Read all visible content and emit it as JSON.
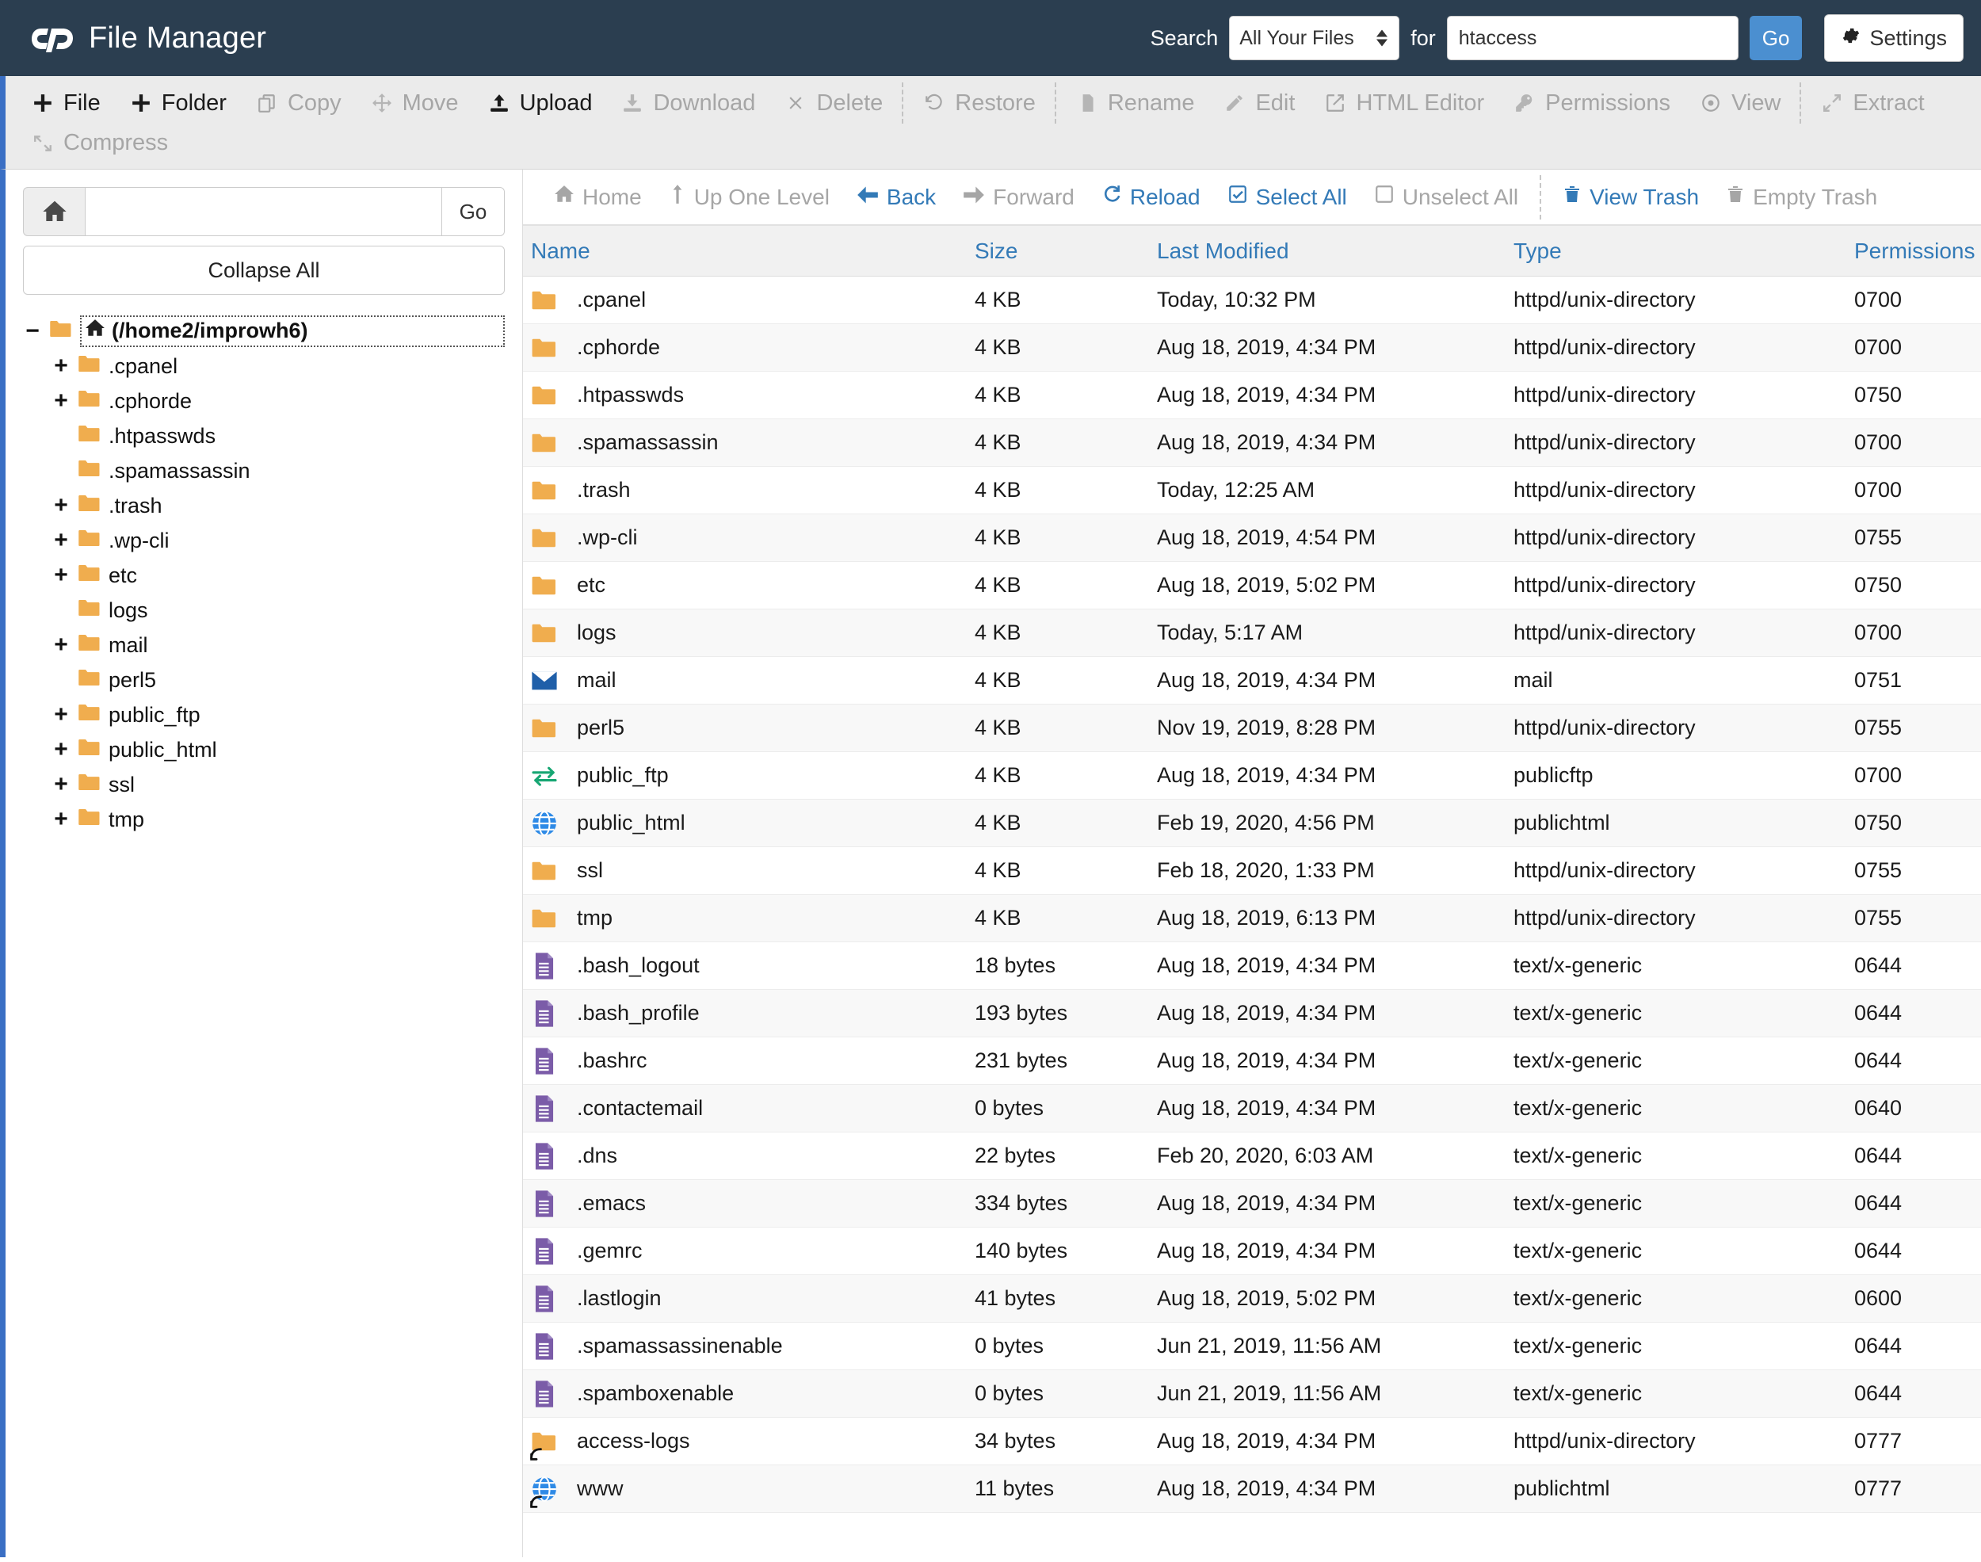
{
  "header": {
    "title": "File Manager",
    "logo_icon": "cpanel-logo-icon",
    "search_label": "Search",
    "search_scope_value": "All Your Files",
    "search_for_label": "for",
    "search_query": "htaccess",
    "search_placeholder": "",
    "go_label": "Go",
    "settings_label": "Settings",
    "settings_icon": "gear-icon",
    "accent_color": "#4b8fd0",
    "background_color": "#2b3e50"
  },
  "toolbar": {
    "row1": [
      {
        "label": "File",
        "icon": "plus-icon",
        "enabled": true
      },
      {
        "label": "Folder",
        "icon": "plus-icon",
        "enabled": true
      },
      {
        "label": "Copy",
        "icon": "copy-icon",
        "enabled": false
      },
      {
        "label": "Move",
        "icon": "move-icon",
        "enabled": false
      },
      {
        "label": "Upload",
        "icon": "upload-icon",
        "enabled": true
      },
      {
        "label": "Download",
        "icon": "download-icon",
        "enabled": false
      },
      {
        "label": "Delete",
        "icon": "x-icon",
        "enabled": false
      },
      {
        "label": "Restore",
        "icon": "restore-icon",
        "enabled": false
      },
      {
        "label": "Rename",
        "icon": "rename-icon",
        "enabled": false
      },
      {
        "label": "Edit",
        "icon": "pencil-icon",
        "enabled": false
      },
      {
        "label": "HTML Editor",
        "icon": "html-editor-icon",
        "enabled": false
      },
      {
        "label": "Permissions",
        "icon": "key-icon",
        "enabled": false
      },
      {
        "label": "View",
        "icon": "eye-icon",
        "enabled": false
      },
      {
        "label": "Extract",
        "icon": "extract-icon",
        "enabled": false
      }
    ],
    "row2": [
      {
        "label": "Compress",
        "icon": "compress-icon",
        "enabled": false
      }
    ]
  },
  "sidebar": {
    "home_icon": "home-icon",
    "path_value": "",
    "path_placeholder": "",
    "go_label": "Go",
    "collapse_all_label": "Collapse All",
    "tree": [
      {
        "label": "(/home2/improwh6)",
        "toggle": "minus",
        "level": 0,
        "icon": "folder-open-home-icon",
        "selected": true
      },
      {
        "label": ".cpanel",
        "toggle": "plus",
        "level": 1,
        "icon": "folder-icon",
        "selected": false
      },
      {
        "label": ".cphorde",
        "toggle": "plus",
        "level": 1,
        "icon": "folder-icon",
        "selected": false
      },
      {
        "label": ".htpasswds",
        "toggle": "none",
        "level": 1,
        "icon": "folder-icon",
        "selected": false
      },
      {
        "label": ".spamassassin",
        "toggle": "none",
        "level": 1,
        "icon": "folder-icon",
        "selected": false
      },
      {
        "label": ".trash",
        "toggle": "plus",
        "level": 1,
        "icon": "folder-icon",
        "selected": false
      },
      {
        "label": ".wp-cli",
        "toggle": "plus",
        "level": 1,
        "icon": "folder-icon",
        "selected": false
      },
      {
        "label": "etc",
        "toggle": "plus",
        "level": 1,
        "icon": "folder-icon",
        "selected": false
      },
      {
        "label": "logs",
        "toggle": "none",
        "level": 1,
        "icon": "folder-icon",
        "selected": false
      },
      {
        "label": "mail",
        "toggle": "plus",
        "level": 1,
        "icon": "folder-icon",
        "selected": false
      },
      {
        "label": "perl5",
        "toggle": "none",
        "level": 1,
        "icon": "folder-icon",
        "selected": false
      },
      {
        "label": "public_ftp",
        "toggle": "plus",
        "level": 1,
        "icon": "folder-icon",
        "selected": false
      },
      {
        "label": "public_html",
        "toggle": "plus",
        "level": 1,
        "icon": "folder-icon",
        "selected": false
      },
      {
        "label": "ssl",
        "toggle": "plus",
        "level": 1,
        "icon": "folder-icon",
        "selected": false
      },
      {
        "label": "tmp",
        "toggle": "plus",
        "level": 1,
        "icon": "folder-icon",
        "selected": false
      }
    ]
  },
  "navbar": [
    {
      "label": "Home",
      "icon": "home-icon",
      "active": false
    },
    {
      "label": "Up One Level",
      "icon": "arrow-up-icon",
      "active": false
    },
    {
      "label": "Back",
      "icon": "arrow-left-icon",
      "active": true
    },
    {
      "label": "Forward",
      "icon": "arrow-right-icon",
      "active": false
    },
    {
      "label": "Reload",
      "icon": "reload-icon",
      "active": true
    },
    {
      "label": "Select All",
      "icon": "checkbox-checked-icon",
      "active": true
    },
    {
      "label": "Unselect All",
      "icon": "checkbox-empty-icon",
      "active": false
    },
    {
      "label": "View Trash",
      "icon": "trash-icon",
      "active": true
    },
    {
      "label": "Empty Trash",
      "icon": "trash-icon",
      "active": false
    }
  ],
  "table": {
    "columns": [
      "Name",
      "Size",
      "Last Modified",
      "Type",
      "Permissions"
    ],
    "rows": [
      {
        "name": ".cpanel",
        "size": "4 KB",
        "modified": "Today, 10:32 PM",
        "type": "httpd/unix-directory",
        "permissions": "0700",
        "icon": "folder-icon"
      },
      {
        "name": ".cphorde",
        "size": "4 KB",
        "modified": "Aug 18, 2019, 4:34 PM",
        "type": "httpd/unix-directory",
        "permissions": "0700",
        "icon": "folder-icon"
      },
      {
        "name": ".htpasswds",
        "size": "4 KB",
        "modified": "Aug 18, 2019, 4:34 PM",
        "type": "httpd/unix-directory",
        "permissions": "0750",
        "icon": "folder-icon"
      },
      {
        "name": ".spamassassin",
        "size": "4 KB",
        "modified": "Aug 18, 2019, 4:34 PM",
        "type": "httpd/unix-directory",
        "permissions": "0700",
        "icon": "folder-icon"
      },
      {
        "name": ".trash",
        "size": "4 KB",
        "modified": "Today, 12:25 AM",
        "type": "httpd/unix-directory",
        "permissions": "0700",
        "icon": "folder-icon"
      },
      {
        "name": ".wp-cli",
        "size": "4 KB",
        "modified": "Aug 18, 2019, 4:54 PM",
        "type": "httpd/unix-directory",
        "permissions": "0755",
        "icon": "folder-icon"
      },
      {
        "name": "etc",
        "size": "4 KB",
        "modified": "Aug 18, 2019, 5:02 PM",
        "type": "httpd/unix-directory",
        "permissions": "0750",
        "icon": "folder-icon"
      },
      {
        "name": "logs",
        "size": "4 KB",
        "modified": "Today, 5:17 AM",
        "type": "httpd/unix-directory",
        "permissions": "0700",
        "icon": "folder-icon"
      },
      {
        "name": "mail",
        "size": "4 KB",
        "modified": "Aug 18, 2019, 4:34 PM",
        "type": "mail",
        "permissions": "0751",
        "icon": "envelope-icon"
      },
      {
        "name": "perl5",
        "size": "4 KB",
        "modified": "Nov 19, 2019, 8:28 PM",
        "type": "httpd/unix-directory",
        "permissions": "0755",
        "icon": "folder-icon"
      },
      {
        "name": "public_ftp",
        "size": "4 KB",
        "modified": "Aug 18, 2019, 4:34 PM",
        "type": "publicftp",
        "permissions": "0700",
        "icon": "exchange-icon"
      },
      {
        "name": "public_html",
        "size": "4 KB",
        "modified": "Feb 19, 2020, 4:56 PM",
        "type": "publichtml",
        "permissions": "0750",
        "icon": "globe-icon"
      },
      {
        "name": "ssl",
        "size": "4 KB",
        "modified": "Feb 18, 2020, 1:33 PM",
        "type": "httpd/unix-directory",
        "permissions": "0755",
        "icon": "folder-icon"
      },
      {
        "name": "tmp",
        "size": "4 KB",
        "modified": "Aug 18, 2019, 6:13 PM",
        "type": "httpd/unix-directory",
        "permissions": "0755",
        "icon": "folder-icon"
      },
      {
        "name": ".bash_logout",
        "size": "18 bytes",
        "modified": "Aug 18, 2019, 4:34 PM",
        "type": "text/x-generic",
        "permissions": "0644",
        "icon": "text-file-icon"
      },
      {
        "name": ".bash_profile",
        "size": "193 bytes",
        "modified": "Aug 18, 2019, 4:34 PM",
        "type": "text/x-generic",
        "permissions": "0644",
        "icon": "text-file-icon"
      },
      {
        "name": ".bashrc",
        "size": "231 bytes",
        "modified": "Aug 18, 2019, 4:34 PM",
        "type": "text/x-generic",
        "permissions": "0644",
        "icon": "text-file-icon"
      },
      {
        "name": ".contactemail",
        "size": "0 bytes",
        "modified": "Aug 18, 2019, 4:34 PM",
        "type": "text/x-generic",
        "permissions": "0640",
        "icon": "text-file-icon"
      },
      {
        "name": ".dns",
        "size": "22 bytes",
        "modified": "Feb 20, 2020, 6:03 AM",
        "type": "text/x-generic",
        "permissions": "0644",
        "icon": "text-file-icon"
      },
      {
        "name": ".emacs",
        "size": "334 bytes",
        "modified": "Aug 18, 2019, 4:34 PM",
        "type": "text/x-generic",
        "permissions": "0644",
        "icon": "text-file-icon"
      },
      {
        "name": ".gemrc",
        "size": "140 bytes",
        "modified": "Aug 18, 2019, 4:34 PM",
        "type": "text/x-generic",
        "permissions": "0644",
        "icon": "text-file-icon"
      },
      {
        "name": ".lastlogin",
        "size": "41 bytes",
        "modified": "Aug 18, 2019, 5:02 PM",
        "type": "text/x-generic",
        "permissions": "0600",
        "icon": "text-file-icon"
      },
      {
        "name": ".spamassassinenable",
        "size": "0 bytes",
        "modified": "Jun 21, 2019, 11:56 AM",
        "type": "text/x-generic",
        "permissions": "0644",
        "icon": "text-file-icon"
      },
      {
        "name": ".spamboxenable",
        "size": "0 bytes",
        "modified": "Jun 21, 2019, 11:56 AM",
        "type": "text/x-generic",
        "permissions": "0644",
        "icon": "text-file-icon"
      },
      {
        "name": "access-logs",
        "size": "34 bytes",
        "modified": "Aug 18, 2019, 4:34 PM",
        "type": "httpd/unix-directory",
        "permissions": "0777",
        "icon": "folder-symlink-icon"
      },
      {
        "name": "www",
        "size": "11 bytes",
        "modified": "Aug 18, 2019, 4:34 PM",
        "type": "publichtml",
        "permissions": "0777",
        "icon": "globe-symlink-icon"
      }
    ]
  },
  "colors": {
    "link_blue": "#337ab7",
    "folder_orange": "#f0ad4e",
    "text_file_purple": "#7b5ca8",
    "envelope_blue": "#1f5fa9",
    "globe_blue": "#2e8ae6",
    "exchange_green": "#17a673",
    "header_navy": "#2b3e50",
    "accent_bar": "#3a6fc4"
  }
}
